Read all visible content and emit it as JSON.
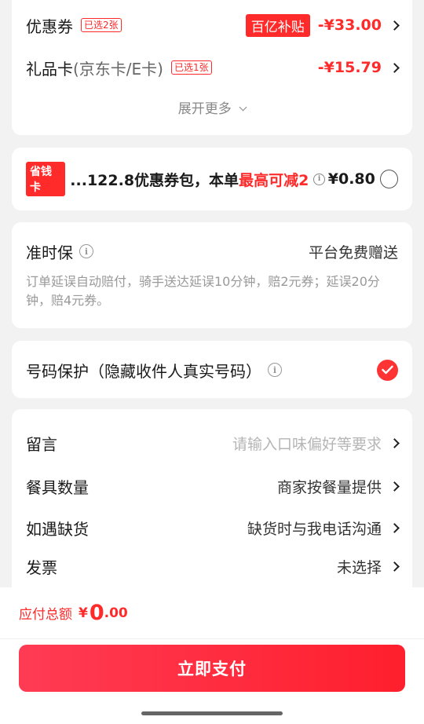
{
  "coupon": {
    "label": "优惠券",
    "selected": "已选2张",
    "badge": "百亿补贴",
    "amount": "-¥33.00"
  },
  "gift_card": {
    "label": "礼品卡",
    "sub": "(京东卡/E卡)",
    "selected": "已选1张",
    "amount": "-¥15.79"
  },
  "expand_more": "展开更多",
  "saver": {
    "badge": "省钱卡",
    "text": "...122.8优惠券包，本单",
    "highlight": "最高可减2",
    "price": "¥0.80"
  },
  "ontime": {
    "title": "准时保",
    "right": "平台免费赠送",
    "desc": "订单延误自动赔付，骑手送达延误10分钟，赔2元券；延误20分钟，赔4元券。"
  },
  "privacy": {
    "label": "号码保护（隐藏收件人真实号码）"
  },
  "options": [
    {
      "label": "留言",
      "value": "请输入口味偏好等要求",
      "placeholder": true
    },
    {
      "label": "餐具数量",
      "value": "商家按餐量提供",
      "placeholder": false
    },
    {
      "label": "如遇缺货",
      "value": "缺货时与我电话沟通",
      "placeholder": false
    },
    {
      "label": "发票",
      "value": "未选择",
      "placeholder": false
    }
  ],
  "total": {
    "label": "应付总额",
    "currency": "¥",
    "integer": "0",
    "decimal": ".00"
  },
  "pay_button": "立即支付",
  "colors": {
    "accent": "#ff2a2a",
    "button_start": "#ff3b54",
    "button_end": "#ff1f2d"
  }
}
